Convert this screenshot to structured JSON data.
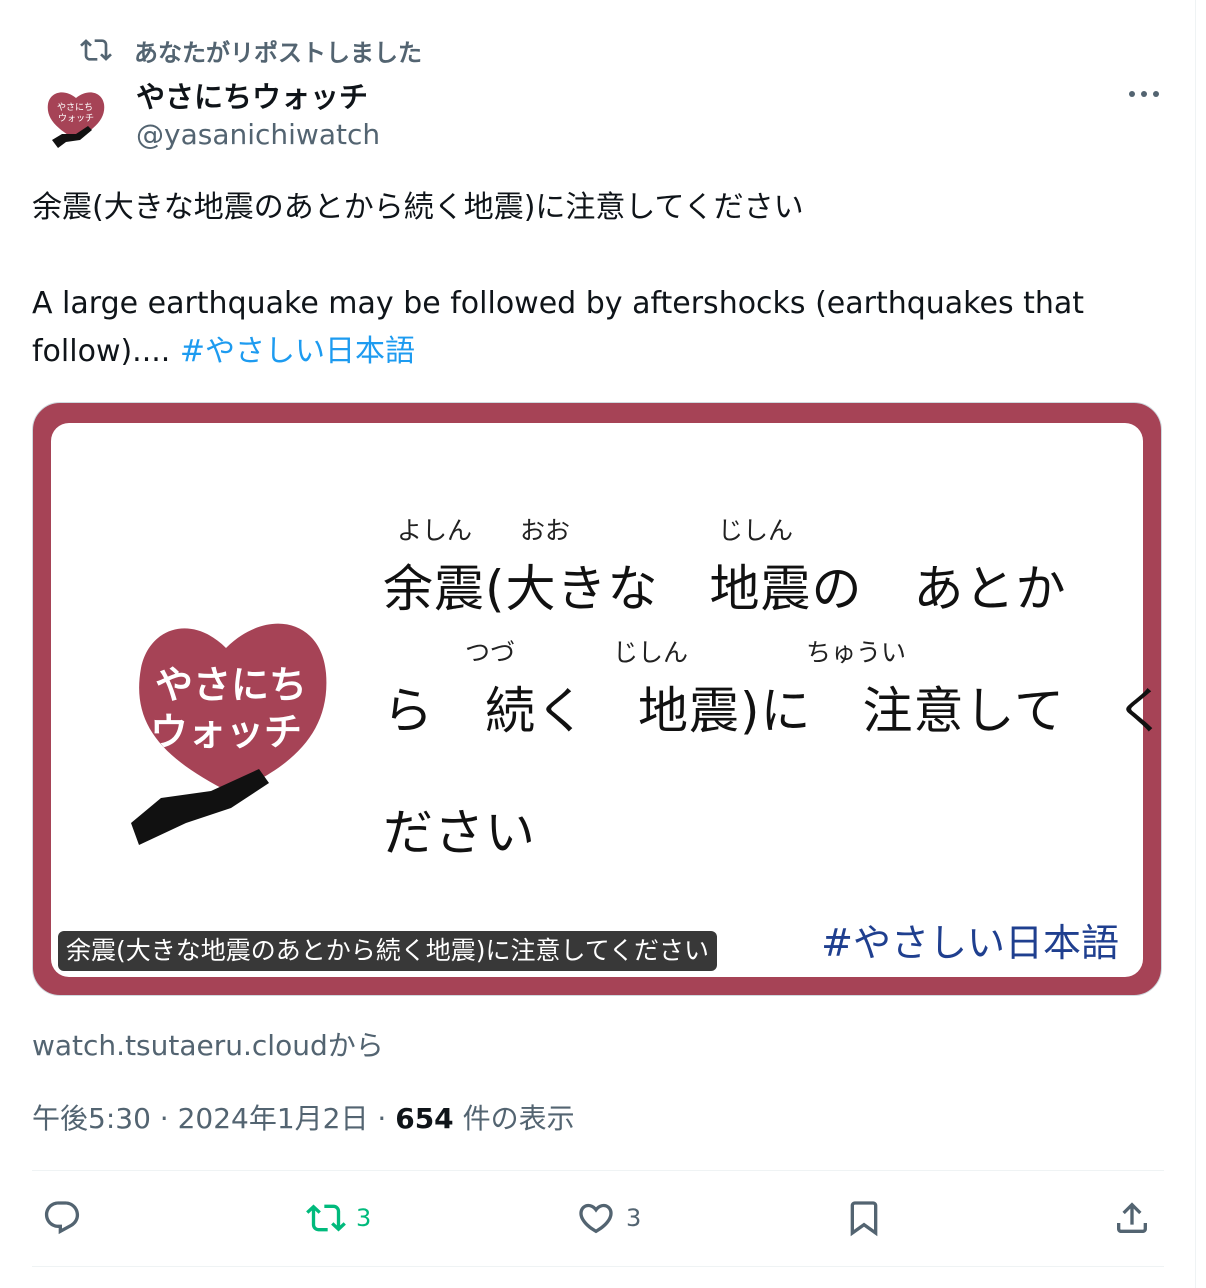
{
  "repost": {
    "label": "あなたがリポストしました",
    "icon": "repost-icon"
  },
  "author": {
    "display_name": "やさにちウォッチ",
    "handle": "@yasanichiwatch",
    "avatar_text_top": "やさにち",
    "avatar_text_bottom": "ウォッチ"
  },
  "tweet": {
    "line1": "余震(大きな地震のあとから続く地震)に注意してください",
    "line2": "A large earthquake may be followed by aftershocks (earthquakes that follow)....",
    "hashtag": "#やさしい日本語"
  },
  "card": {
    "logo_top": "やさにち",
    "logo_bottom": "ウォッチ",
    "ruby1": [
      "よしん",
      "おお",
      "じしん"
    ],
    "main1": "余震(大きな　地震の　あとか",
    "ruby2": [
      "つづ",
      "じしん",
      "ちゅうい"
    ],
    "main2": "ら　続く　地震)に　注意して　く",
    "main3": "ださい",
    "hashtag": "#やさしい日本語",
    "caption": "余震(大きな地震のあとから続く地震)に注意してください",
    "accent_color": "#a64356"
  },
  "source": "watch.tsutaeru.cloudから",
  "meta": {
    "time": "午後5:30",
    "date": "2024年1月2日",
    "views_count": "654",
    "views_label": "件の表示"
  },
  "actions": {
    "reply": {
      "icon": "reply-icon"
    },
    "repost": {
      "icon": "repost-icon",
      "count": "3",
      "color": "#00ba7c"
    },
    "like": {
      "icon": "heart-icon",
      "count": "3"
    },
    "bookmark": {
      "icon": "bookmark-icon"
    },
    "share": {
      "icon": "share-icon"
    }
  }
}
